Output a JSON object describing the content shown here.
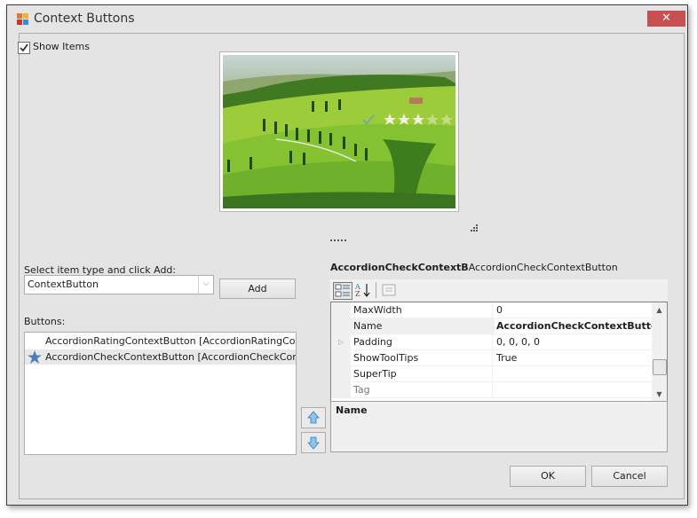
{
  "window": {
    "title": "Context Buttons",
    "close_label": "✕"
  },
  "show_items": {
    "label": "Show Items",
    "checked": true
  },
  "preview": {
    "rating_stars_filled": 3,
    "rating_stars_total": 5,
    "check_icon": "check-icon"
  },
  "add_section": {
    "label": "Select item type and click Add:",
    "combo_value": "ContextButton",
    "add_button": "Add"
  },
  "buttons_list": {
    "label": "Buttons:",
    "items": [
      {
        "text": "AccordionRatingContextButton [AccordionRatingContextButton]",
        "selected": false,
        "icon": ""
      },
      {
        "text": "AccordionCheckContextButton [AccordionCheckContextButton]",
        "selected": true,
        "icon": "star-icon"
      }
    ]
  },
  "property_grid": {
    "title_bold": "AccordionCheckContextB",
    "title_regular": "AccordionCheckContextButton",
    "rows": [
      {
        "name": "MaxWidth",
        "value": "0",
        "bold": false,
        "expandable": false,
        "disabled": false
      },
      {
        "name": "Name",
        "value": "AccordionCheckContextButton",
        "bold": true,
        "expandable": false,
        "disabled": false
      },
      {
        "name": "Padding",
        "value": "0, 0, 0, 0",
        "bold": false,
        "expandable": true,
        "disabled": false
      },
      {
        "name": "ShowToolTips",
        "value": "True",
        "bold": false,
        "expandable": false,
        "disabled": false
      },
      {
        "name": "SuperTip",
        "value": "",
        "bold": false,
        "expandable": false,
        "disabled": false
      },
      {
        "name": "Tag",
        "value": "",
        "bold": false,
        "expandable": false,
        "disabled": true
      }
    ],
    "description_title": "Name"
  },
  "footer": {
    "ok": "OK",
    "cancel": "Cancel"
  },
  "colors": {
    "close_button": "#c75050",
    "accent_blue": "#4a7ebb"
  }
}
